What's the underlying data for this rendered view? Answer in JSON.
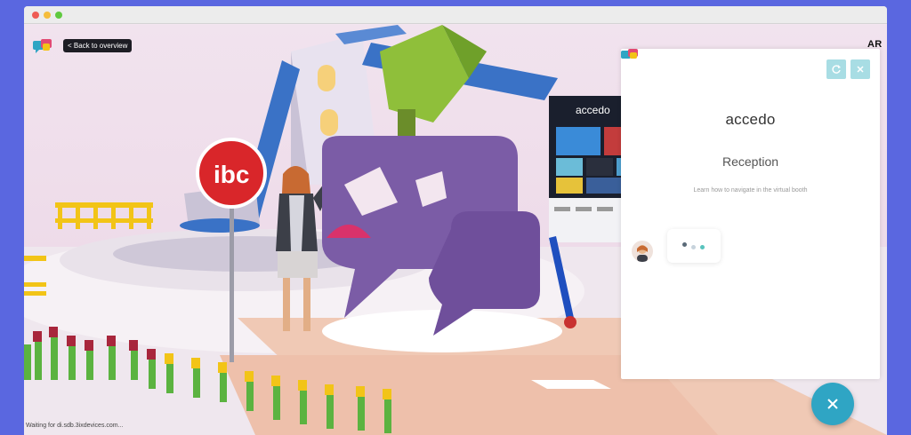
{
  "browser": {
    "controls": [
      "close",
      "minimize",
      "maximize"
    ]
  },
  "scene": {
    "back_label": "< Back to overview",
    "ar_label": "AR",
    "status": "Waiting for di.sdb.3ixdevices.com...",
    "booth_screen_brand": "accedo",
    "sign_logo": "ibc"
  },
  "panel": {
    "brand": "accedo",
    "title": "Reception",
    "subtitle": "Learn how to navigate in the virtual booth",
    "icons": [
      "refresh-icon",
      "close-icon"
    ]
  },
  "fab": {
    "icon": "close-icon"
  },
  "colors": {
    "frame": "#5a67e0",
    "accent": "#2fa5c4",
    "panel_button": "#a8dde4",
    "scene_purple": "#7b5ca6"
  }
}
